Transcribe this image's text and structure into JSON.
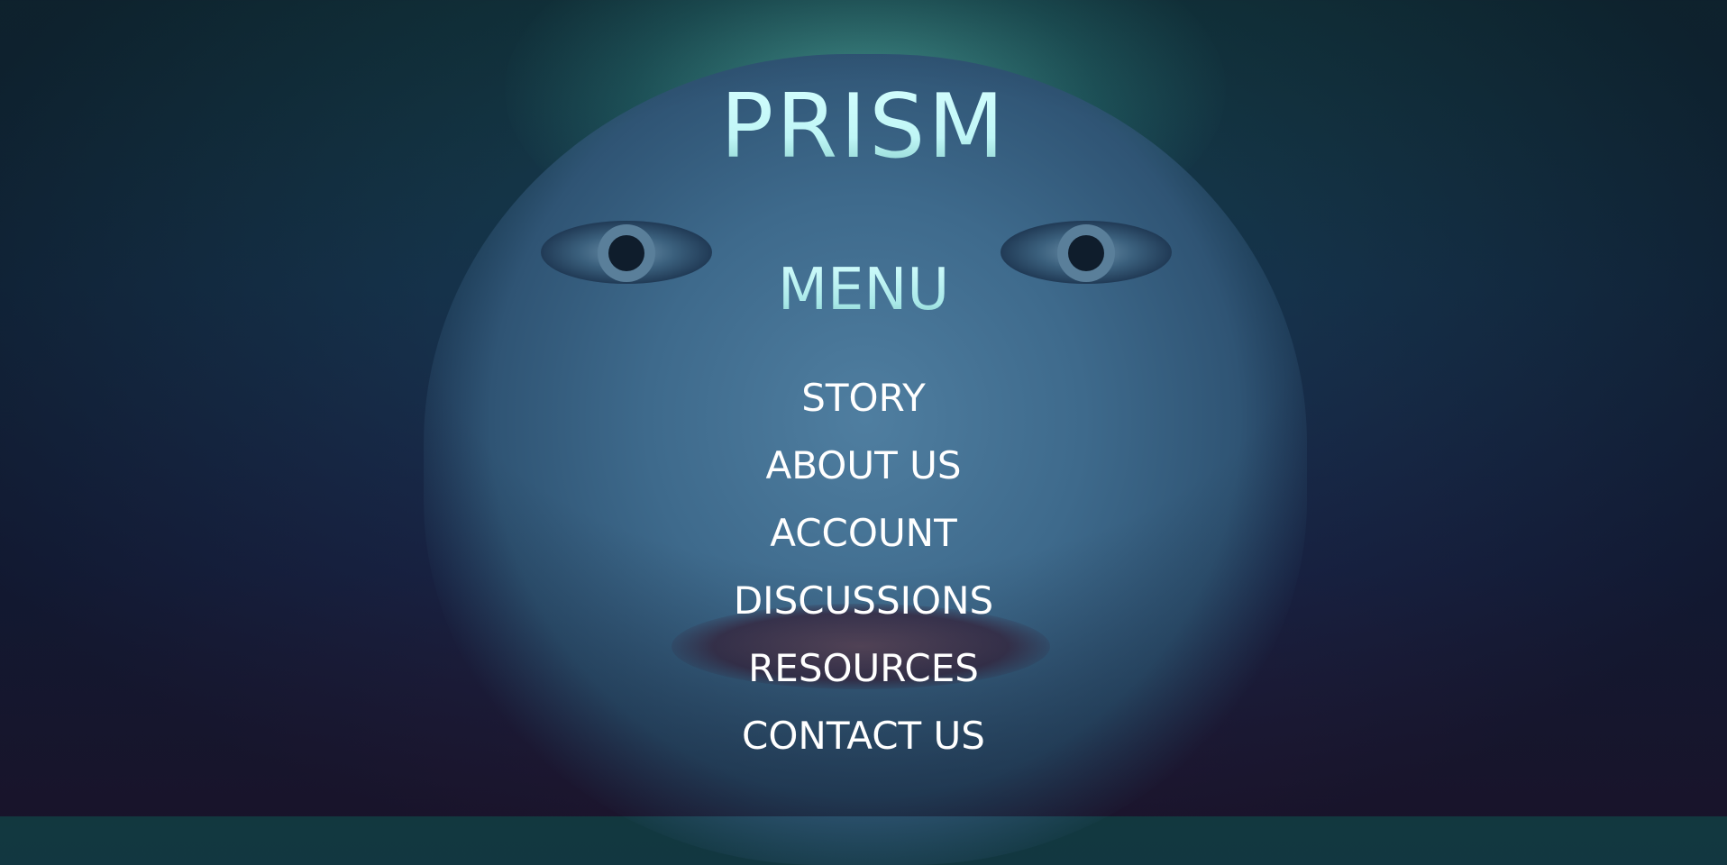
{
  "brand": {
    "title": "PRISM"
  },
  "menu": {
    "heading": "MENU",
    "items": [
      {
        "label": "STORY"
      },
      {
        "label": "ABOUT US"
      },
      {
        "label": "ACCOUNT"
      },
      {
        "label": "DISCUSSIONS"
      },
      {
        "label": "RESOURCES"
      },
      {
        "label": "CONTACT US"
      }
    ]
  }
}
